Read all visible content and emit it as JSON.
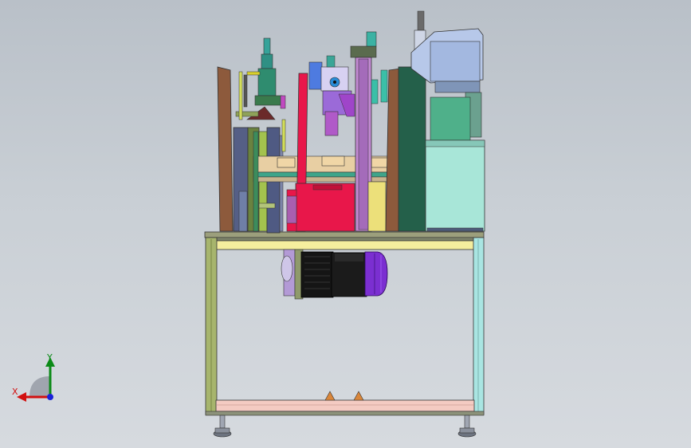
{
  "viewport": {
    "background_top": "#b9c0c8",
    "background_bottom": "#d6dadf"
  },
  "triad": {
    "x_label": "X",
    "y_label": "Y",
    "x_color": "#d21010",
    "y_color": "#0b8a17",
    "z_color": "#1a22d8"
  },
  "model": {
    "frame_color": "#9aa968",
    "motor_color": "#7b2fd1",
    "body_red": "#e8174a",
    "body_teal": "#a8e6d8"
  }
}
